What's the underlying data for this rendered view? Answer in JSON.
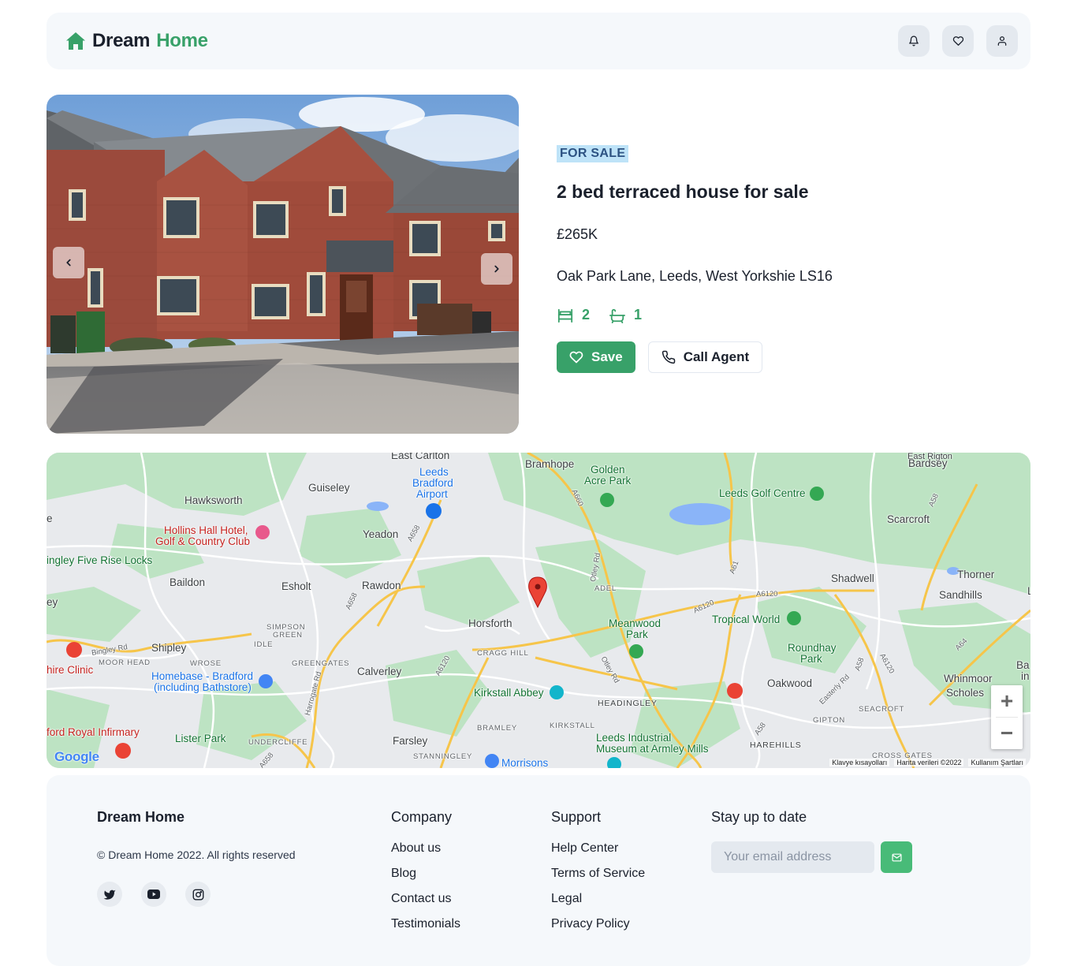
{
  "header": {
    "brand_part1": "Dream",
    "brand_part2": "Home",
    "icons": [
      "bell-icon",
      "heart-icon",
      "user-icon"
    ]
  },
  "listing": {
    "badge": "FOR SALE",
    "title": "2 bed terraced house for sale",
    "price": "£265K",
    "address": "Oak Park Lane, Leeds, West Yorkshie LS16",
    "bedrooms": "2",
    "bathrooms": "1",
    "save_label": "Save",
    "call_label": "Call Agent"
  },
  "map": {
    "labels": {
      "east_carlton": "East Carlton",
      "bramhope": "Bramhope",
      "golden_acre": "Golden",
      "golden_acre2": "Acre Park",
      "bardsey": "Bardsey",
      "leeds_airport1": "Leeds",
      "leeds_airport2": "Bradford",
      "leeds_airport3": "Airport",
      "guiseley": "Guiseley",
      "hawksworth": "Hawksworth",
      "leeds_golf": "Leeds Golf Centre",
      "scarcroft": "Scarcroft",
      "hollins1": "Hollins Hall Hotel,",
      "hollins2": "Golf & Country Club",
      "yeadon": "Yeadon",
      "bingley": "ingley Five Rise Locks",
      "thorner": "Thorner",
      "shadwell": "Shadwell",
      "sandhills": "Sandhills",
      "baildon": "Baildon",
      "esholt": "Esholt",
      "rawdon": "Rawdon",
      "adel": "ADEL",
      "tropical": "Tropical World",
      "horsforth": "Horsforth",
      "meanwood1": "Meanwood",
      "meanwood2": "Park",
      "simpson1": "SIMPSON",
      "simpson2": "GREEN",
      "shipley": "Shipley",
      "idle": "IDLE",
      "cragg": "CRAGG HILL",
      "roundhay1": "Roundhay",
      "roundhay2": "Park",
      "whinmoor": "Whinmoor",
      "moorhead": "MOOR HEAD",
      "wrose": "WROSE",
      "greengates": "GREENGATES",
      "calverley": "Calverley",
      "oakwood": "Oakwood",
      "scholes": "Scholes",
      "clinic": "hire Clinic",
      "homebase1": "Homebase - Bradford",
      "homebase2": "(including Bathstore)",
      "kirkstall_abbey": "Kirkstall Abbey",
      "headingley": "HEADINGLEY",
      "seacroft": "SEACROFT",
      "gipton": "GIPTON",
      "royal": "ford Royal Infirmary",
      "bramley": "BRAMLEY",
      "kirkstall": "KIRKSTALL",
      "lister": "Lister Park",
      "undercliffe": "UNDERCLIFFE",
      "farsley": "Farsley",
      "leeds_ind1": "Leeds Industrial",
      "leeds_ind2": "Museum at Armley Mills",
      "harehills": "HAREHILLS",
      "stanningley": "STANNINGLEY",
      "morrisons": "Morrisons",
      "cross_gates": "CROSS GATES",
      "bingley_rd": "Bingley Rd",
      "harrogate_rd": "Harrogate Rd",
      "otley_rd1": "Otley Rd",
      "otley_rd2": "Otley Rd",
      "easterly": "Easterly Rd",
      "a6120a": "A6120",
      "a6120b": "A6120",
      "a6120c": "A6120",
      "a6120d": "A6120",
      "a658a": "A658",
      "a658b": "A658",
      "a658c": "A658",
      "a660": "A660",
      "a61": "A61",
      "a58a": "A58",
      "a58b": "A58",
      "a58c": "A58",
      "a64": "A64",
      "ey": "ey",
      "e": "e",
      "ba": "Ba",
      "in": "in",
      "l": "L",
      "east_rigton": "East Rigton"
    },
    "footer_links": [
      "Klavye kısayolları",
      "Harita verileri ©2022",
      "Kullanım Şartları"
    ],
    "google": "Google",
    "zoom_in": "+",
    "zoom_out": "−"
  },
  "footer": {
    "brand": "Dream Home",
    "copyright": "© Dream Home 2022. All rights reserved",
    "social": [
      "twitter-icon",
      "youtube-icon",
      "instagram-icon"
    ],
    "company": {
      "heading": "Company",
      "links": [
        "About us",
        "Blog",
        "Contact us",
        "Testimonials"
      ]
    },
    "support": {
      "heading": "Support",
      "links": [
        "Help Center",
        "Terms of Service",
        "Legal",
        "Privacy Policy"
      ]
    },
    "newsletter": {
      "heading": "Stay up to date",
      "placeholder": "Your email address"
    }
  },
  "colors": {
    "brand_green": "#38a169",
    "badge_bg": "#bee3f8",
    "badge_text": "#2c5282"
  }
}
